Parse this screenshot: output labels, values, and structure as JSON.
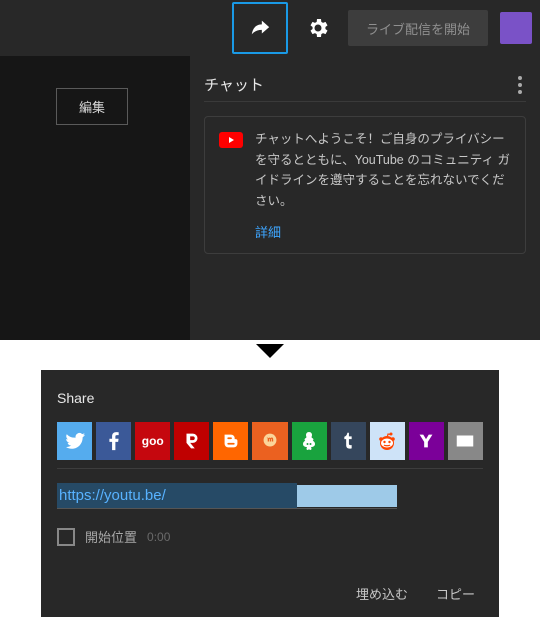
{
  "toolbar": {
    "start_stream": "ライブ配信を開始"
  },
  "left": {
    "edit": "編集"
  },
  "chat": {
    "title": "チャット",
    "welcome": "チャットへようこそ！ご自身のプライバシーを守るとともに、YouTube のコミュニティ ガイドラインを遵守することを忘れないでください。",
    "learn_more": "詳細"
  },
  "share": {
    "title": "Share",
    "url": "https://youtu.be/",
    "start_at_label": "開始位置",
    "start_at_time": "0:00",
    "embed": "埋め込む",
    "copy": "コピー",
    "icons": {
      "goo_label": "goo"
    }
  }
}
